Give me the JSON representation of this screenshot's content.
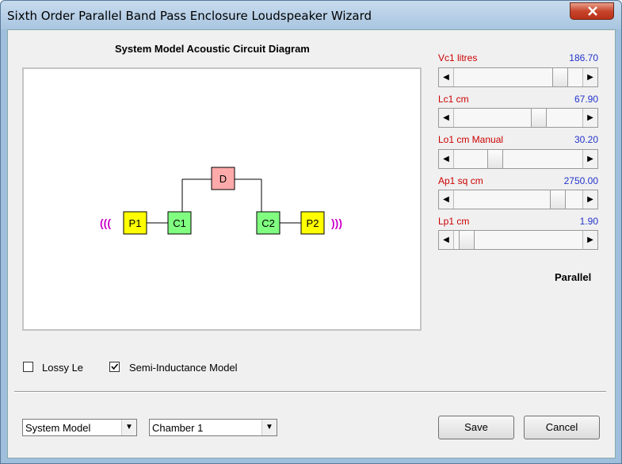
{
  "window": {
    "title": "Sixth Order Parallel Band Pass Enclosure Loudspeaker Wizard"
  },
  "diagram": {
    "title": "System Model Acoustic Circuit Diagram",
    "nodes": {
      "d": "D",
      "p1": "P1",
      "c1": "C1",
      "c2": "C2",
      "p2": "P2"
    },
    "left_wave": "(((",
    "right_wave": ")))",
    "colors": {
      "port": "#ffff00",
      "chamber": "#80ff80",
      "driver": "#ffaaaa",
      "wave": "#cc00cc"
    }
  },
  "params": [
    {
      "label": "Vc1  litres",
      "value": "186.70",
      "fraction": 0.87
    },
    {
      "label": "Lc1  cm",
      "value": "67.90",
      "fraction": 0.68
    },
    {
      "label": "Lo1  cm  Manual",
      "value": "30.20",
      "fraction": 0.3
    },
    {
      "label": "Ap1  sq cm",
      "value": "2750.00",
      "fraction": 0.85
    },
    {
      "label": "Lp1  cm",
      "value": "1.90",
      "fraction": 0.05
    }
  ],
  "mode_label": "Parallel",
  "checkboxes": {
    "lossy": {
      "label": "Lossy Le",
      "checked": false
    },
    "semi": {
      "label": "Semi-Inductance Model",
      "checked": true
    }
  },
  "selectors": {
    "model": "System Model",
    "chamber": "Chamber 1"
  },
  "buttons": {
    "save": "Save",
    "cancel": "Cancel"
  }
}
